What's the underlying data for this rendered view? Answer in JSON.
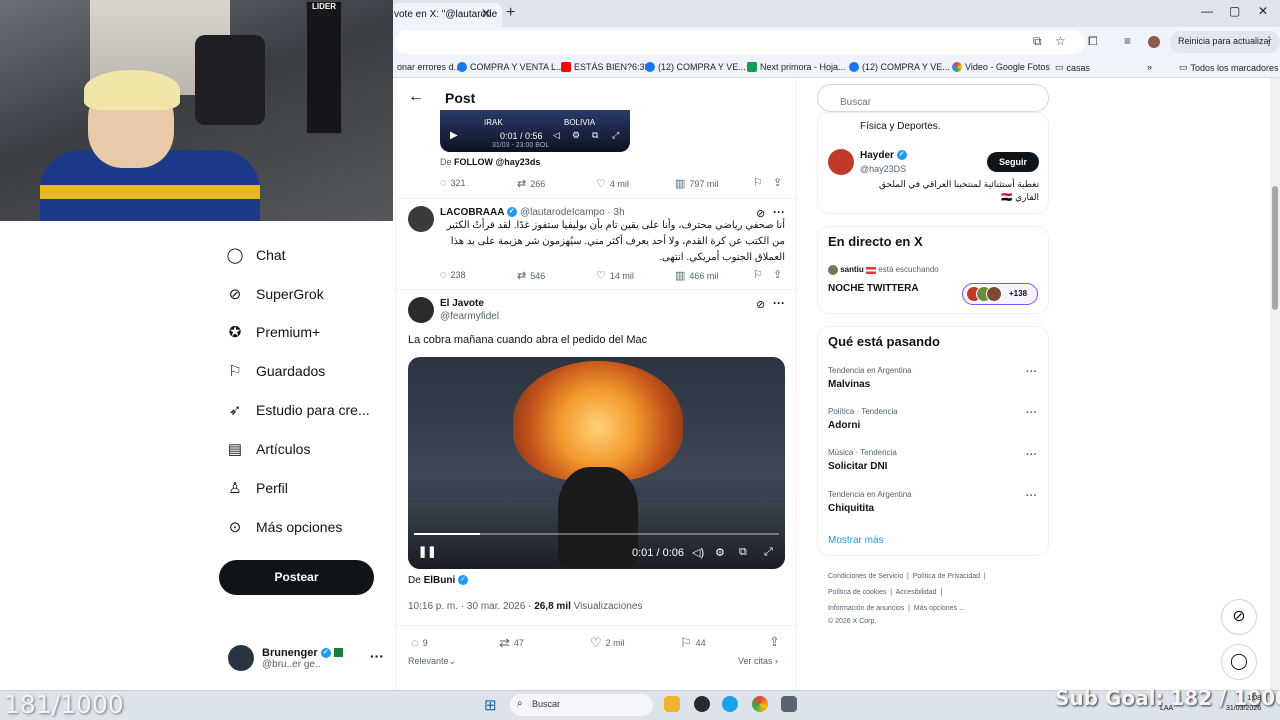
{
  "browser": {
    "tab_title": "vote en X: \"@lautarode",
    "update_label": "Reinicia para actualizar",
    "bookmarks": [
      "onar errores d...",
      "COMPRA Y VENTA L...",
      "ESTÁS BIEN?6:33",
      "(12) COMPRA Y VE...",
      "Next primora - Hoja...",
      "(12) COMPRA Y VE...",
      "Video - Google Fotos",
      "casas"
    ],
    "bookmarks_all": "Todos los marcadores"
  },
  "webcam": {
    "fridge_label": "LIDER"
  },
  "nav": {
    "items": [
      "Chat",
      "SuperGrok",
      "Premium+",
      "Guardados",
      "Estudio para cre...",
      "Artículos",
      "Perfil",
      "Más opciones"
    ],
    "post_button": "Postear",
    "account_name": "Brunenger",
    "account_handle": "@bru..er ge.."
  },
  "post": {
    "header_title": "Post",
    "prev_video": {
      "team_left": "IRAK",
      "team_right": "BOLIVIA",
      "time": "0:01 / 0:56",
      "caption": "31/03 - 23:00 BOL"
    },
    "from_prefix": "De",
    "from_handle": "FOLLOW @hay23ds",
    "prev_actions": {
      "replies": "321",
      "reposts": "266",
      "likes": "4 mil",
      "views": "797 mil"
    },
    "reply1": {
      "name": "LACOBRAAA",
      "handle": "@lautarodeIcampo · 3h",
      "text": "أنا صحفي رياضي محترف، وأنا على يقين تام بأن بوليفيا ستفوز غدًا. لقد قرأتُ الكثير من الكتب عن كرة القدم، ولا أحد يعرف أكثر مني. سيُهزمون شر هزيمة على يد هذا العملاق الجنوب أمريكي. انتهى.",
      "replies": "238",
      "reposts": "546",
      "likes": "14 mil",
      "views": "466 mil"
    },
    "main": {
      "name": "El Javote",
      "handle": "@fearmyfidel",
      "text": "La cobra mañana cuando abra el pedido del Mac",
      "video_time": "0:01 / 0:06",
      "video_progress": 0.18,
      "source_prefix": "De",
      "source_name": "ElBuni",
      "timestamp": "10:16 p. m. · 30 mar. 2026 ·",
      "views_count": "26,8 mil",
      "views_label": "Visualizaciones",
      "replies": "9",
      "reposts": "47",
      "likes": "2 mil",
      "bookmarks": "44"
    },
    "relevant": "Relevante",
    "see_quotes": "Ver citas"
  },
  "right": {
    "search_placeholder": "Buscar",
    "suggest_tail": "Física y Deportes.",
    "suggest": {
      "name": "Hayder",
      "handle": "@hay23DS",
      "follow": "Seguir",
      "bio": "تغطية أستثنائية لمنتخبنا العراقي في الملحق القاري 🇮🇶"
    },
    "live": {
      "title": "En directo en X",
      "host": "santiu",
      "listening": "está escuchando",
      "space_title": "NOCHE TWITTERA",
      "count": "+138"
    },
    "trending_title": "Qué está pasando",
    "trends": [
      {
        "meta": "Tendencia en Argentina",
        "name": "Malvinas"
      },
      {
        "meta": "Política · Tendencia",
        "name": "Adorni"
      },
      {
        "meta": "Música · Tendencia",
        "name": "Solicitar DNI"
      },
      {
        "meta": "Tendencia en Argentina",
        "name": "Chiquitita"
      }
    ],
    "show_more": "Mostrar más",
    "footer": {
      "l1a": "Condiciones de Servicio",
      "l1b": "Política de Privacidad",
      "l2a": "Política de cookies",
      "l2b": "Accesibilidad",
      "l3a": "Información de anuncios",
      "l3b": "Más opciones ...",
      "copy": "© 2026 X Corp."
    }
  },
  "overlay": {
    "counter_left": "181/1000",
    "counter_right": "Sub Goal: 182 / 1000"
  },
  "taskbar": {
    "search": "Buscar",
    "lang": "LAA",
    "time": "1:08",
    "date": "31/03/2026"
  },
  "colors": {
    "accent": "#1d9bf0",
    "dark": "#0f1419",
    "muted": "#536471"
  }
}
